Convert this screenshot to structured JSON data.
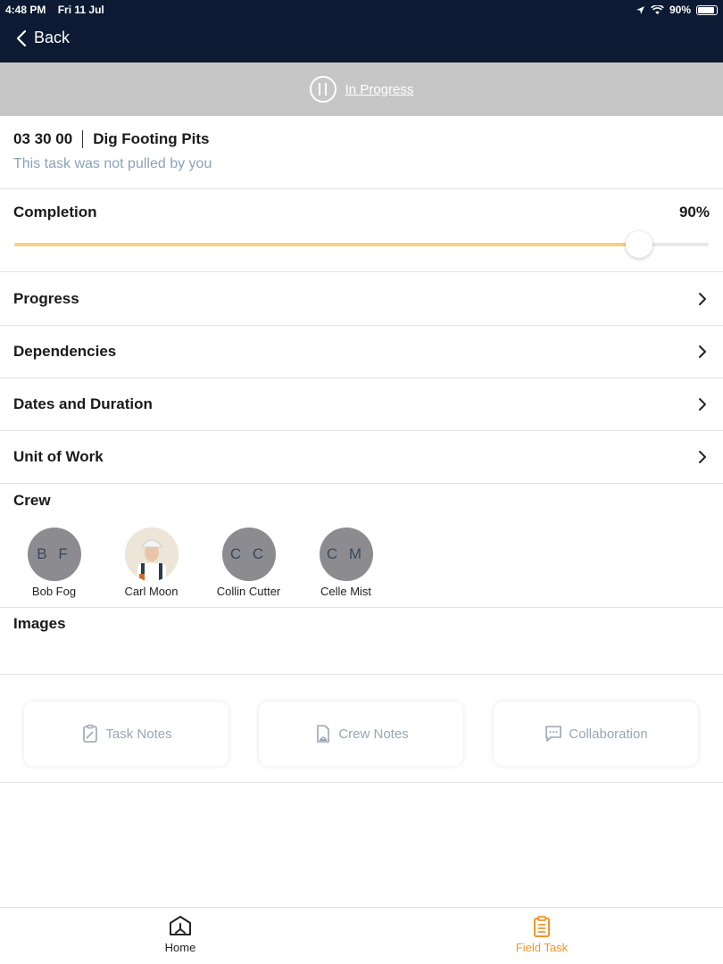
{
  "status_bar": {
    "time": "4:48 PM",
    "date": "Fri 11 Jul",
    "battery": "90%"
  },
  "nav": {
    "back_label": "Back"
  },
  "task_status": {
    "label": "In Progress"
  },
  "task": {
    "code": "03 30 00",
    "name": "Dig Footing Pits",
    "note": "This task was not pulled by you"
  },
  "completion": {
    "label": "Completion",
    "value_text": "90%",
    "value": 0.9,
    "accent": "#f7cf85"
  },
  "menu": [
    {
      "label": "Progress"
    },
    {
      "label": "Dependencies"
    },
    {
      "label": "Dates and Duration"
    },
    {
      "label": "Unit of Work"
    }
  ],
  "crew": {
    "title": "Crew",
    "members": [
      {
        "initials": "B F",
        "name": "Bob Fog"
      },
      {
        "initials": "",
        "name": "Carl Moon"
      },
      {
        "initials": "C C",
        "name": "Collin Cutter"
      },
      {
        "initials": "C M",
        "name": "Celle Mist"
      }
    ]
  },
  "images": {
    "title": "Images"
  },
  "notes": {
    "task_notes": "Task Notes",
    "crew_notes": "Crew Notes",
    "collaboration": "Collaboration"
  },
  "tabs": {
    "home": "Home",
    "field_task": "Field Task",
    "active_color": "#f0962d"
  }
}
